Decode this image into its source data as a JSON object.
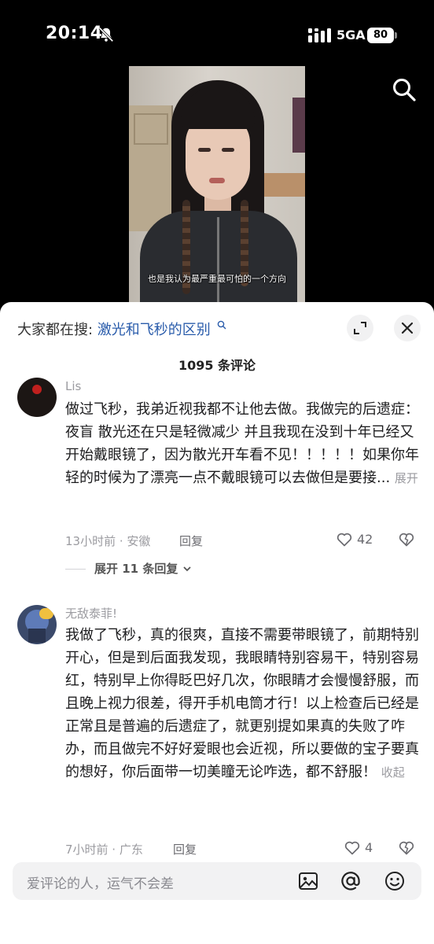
{
  "status_bar": {
    "time": "20:14",
    "network": "5GA",
    "battery": "80"
  },
  "video": {
    "caption": "也是我认为最严重最可怕的一个方向"
  },
  "sheet": {
    "search_label": "大家都在搜:",
    "search_query": "激光和飞秒的区别",
    "comment_count": "1095 条评论"
  },
  "comments": [
    {
      "username": "Lis",
      "text": "做过飞秒，我弟近视我都不让他去做。我做完的后遗症： 夜盲  散光还在只是轻微减少  并且我现在没到十年已经又开始戴眼镜了，因为散光开车看不见！！！！！如果你年轻的时候为了漂亮一点不戴眼镜可以去做但是要接...",
      "more_label": "展开",
      "time_location": "13小时前 · 安徽",
      "reply_label": "回复",
      "likes": "42",
      "expand_replies": "展开 11 条回复"
    },
    {
      "username": "无敌泰菲!",
      "text": "我做了飞秒，真的很爽，直接不需要带眼镜了，前期特别开心，但是到后面我发现，我眼睛特别容易干，特别容易红，特别早上你得眨巴好几次，你眼睛才会慢慢舒服，而且晚上视力很差，得开手机电筒才行！以上检查后已经是正常且是普遍的后遗症了，就更别提如果真的失败了咋办，而且做完不好好爱眼也会近视，所以要做的宝子要真的想好，你后面带一切美瞳无论咋选，都不舒服！",
      "more_label": "收起",
      "time_location": "7小时前 · 广东",
      "reply_label": "回复",
      "likes": "4"
    }
  ],
  "input": {
    "placeholder": "爱评论的人，运气不会差"
  },
  "icons": {
    "mute": "bell-slash-icon",
    "signal": "signal-icon",
    "search": "search-icon",
    "expand": "expand-icon",
    "close": "close-icon",
    "like": "heart-icon",
    "dislike": "broken-heart-icon",
    "image": "image-icon",
    "mention": "at-icon",
    "emoji": "emoji-icon"
  },
  "colors": {
    "query": "#2a5cab",
    "muted_text": "#9b9ba0"
  }
}
